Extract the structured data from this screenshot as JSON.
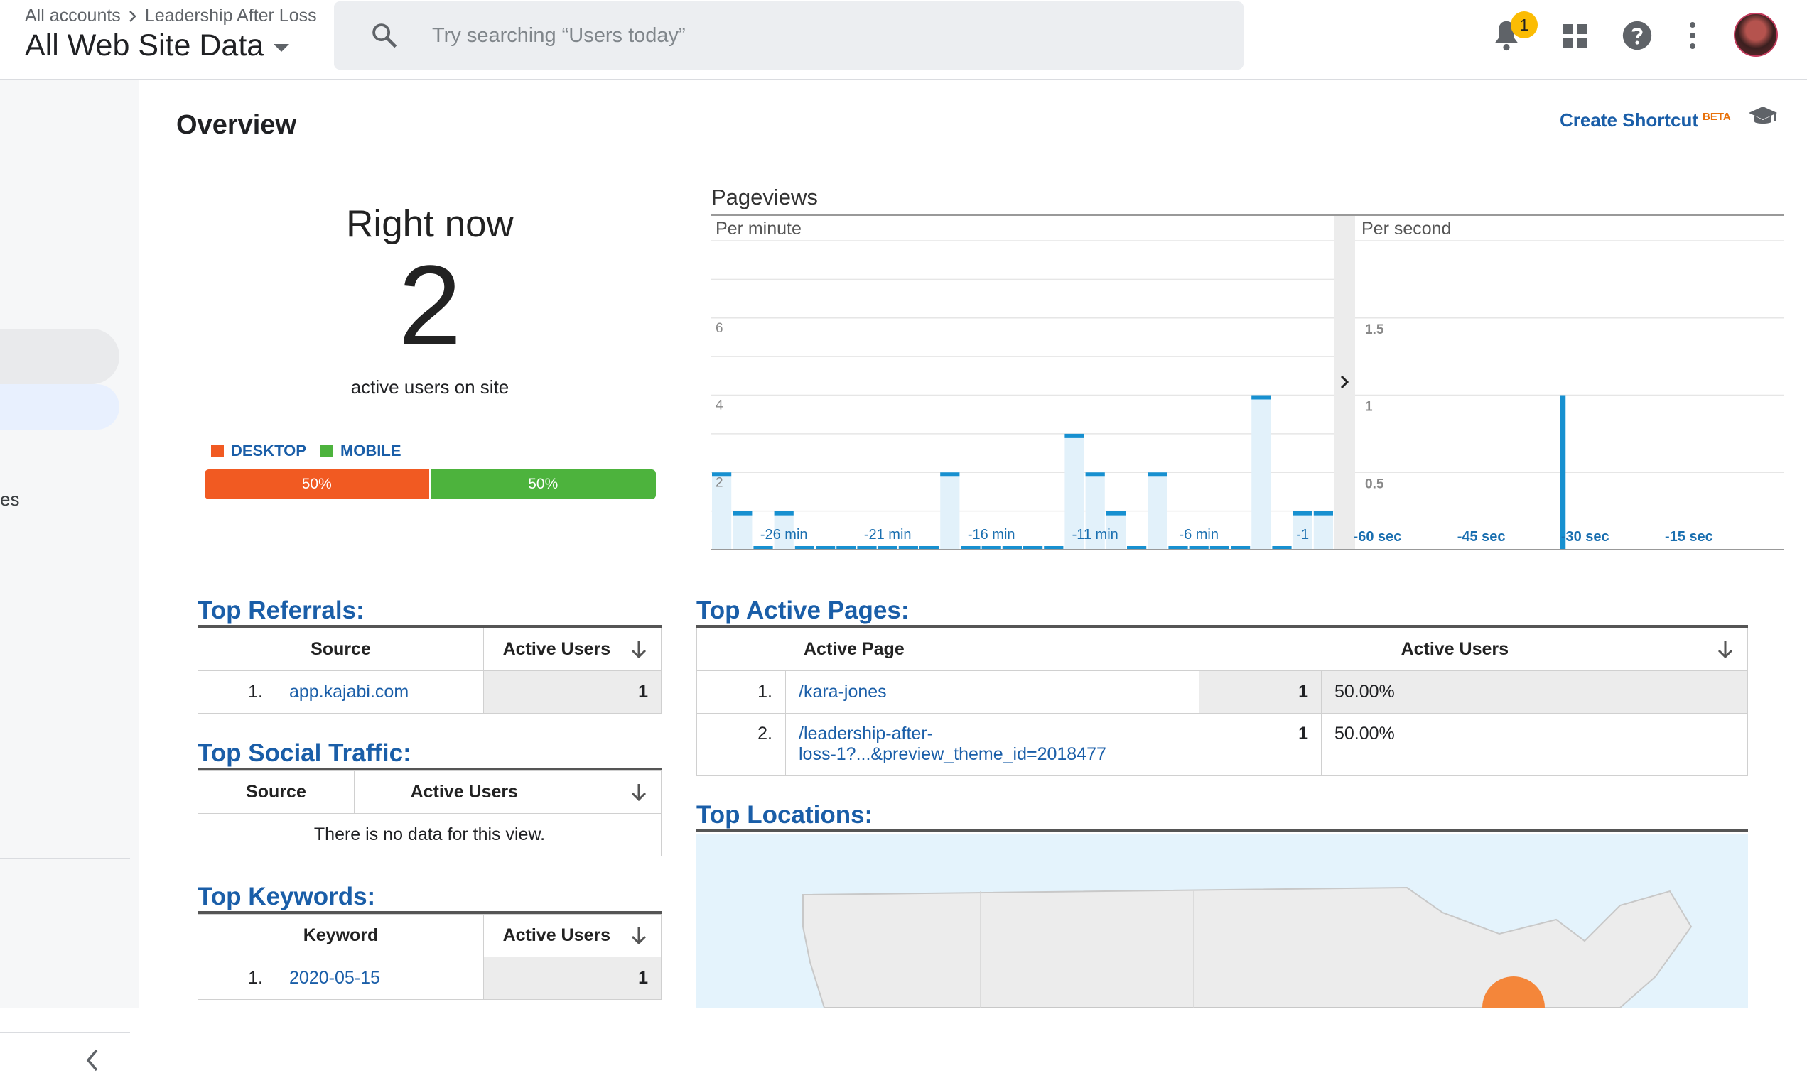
{
  "header": {
    "breadcrumb": [
      "All accounts",
      "Leadership After Loss"
    ],
    "property": "All Web Site Data",
    "search_placeholder": "Try searching “Users today”",
    "notification_count": "1"
  },
  "sidebar": {
    "fragment": "es"
  },
  "overview": {
    "title": "Overview",
    "shortcut_label": "Create Shortcut",
    "shortcut_beta": "BETA"
  },
  "right_now": {
    "title": "Right now",
    "count": "2",
    "subtitle": "active users on site",
    "legend": [
      {
        "label": "DESKTOP",
        "color": "#f15a22"
      },
      {
        "label": "MOBILE",
        "color": "#4db33d"
      }
    ],
    "split": [
      {
        "label": "50%",
        "value": 50,
        "color": "#f15a22"
      },
      {
        "label": "50%",
        "value": 50,
        "color": "#4db33d"
      }
    ]
  },
  "pageviews": {
    "title": "Pageviews",
    "per_minute_label": "Per minute",
    "per_second_label": "Per second",
    "chart_data": [
      {
        "type": "bar",
        "title": "Per minute",
        "x_ticks": [
          "-26 min",
          "-21 min",
          "-16 min",
          "-11 min",
          "-6 min",
          "-1"
        ],
        "y_ticks": [
          "2",
          "4",
          "6"
        ],
        "ylim": [
          0,
          8
        ],
        "values": [
          2,
          1,
          0,
          1,
          0,
          0,
          0,
          0,
          0,
          0,
          0,
          2,
          0,
          0,
          0,
          0,
          0,
          3,
          2,
          1,
          0,
          2,
          0,
          0,
          0,
          0,
          4,
          0,
          1,
          1
        ]
      },
      {
        "type": "bar",
        "title": "Per second",
        "x_ticks": [
          "-60 sec",
          "-45 sec",
          "-30 sec",
          "-15 sec"
        ],
        "y_ticks": [
          "0.5",
          "1",
          "1.5"
        ],
        "ylim": [
          0,
          2
        ],
        "spike": {
          "x": -32,
          "value": 1
        }
      }
    ]
  },
  "top_referrals": {
    "title": "Top Referrals:",
    "columns": [
      "Source",
      "Active Users"
    ],
    "rows": [
      {
        "index": "1.",
        "source": "app.kajabi.com",
        "users": "1"
      }
    ]
  },
  "top_social": {
    "title": "Top Social Traffic:",
    "columns": [
      "Source",
      "Active Users"
    ],
    "empty": "There is no data for this view."
  },
  "top_keywords": {
    "title": "Top Keywords:",
    "columns": [
      "Keyword",
      "Active Users"
    ],
    "rows": [
      {
        "index": "1.",
        "keyword": "2020-05-15",
        "users": "1"
      }
    ]
  },
  "top_pages": {
    "title": "Top Active Pages:",
    "columns": [
      "Active Page",
      "Active Users"
    ],
    "rows": [
      {
        "index": "1.",
        "page": "/kara-jones",
        "users": "1",
        "percent": "50.00%"
      },
      {
        "index": "2.",
        "page_line1": "/leadership-after-",
        "page_line2": "loss-1?...&preview_theme_id=2018477",
        "users": "1",
        "percent": "50.00%"
      }
    ]
  },
  "top_locations": {
    "title": "Top Locations:"
  }
}
